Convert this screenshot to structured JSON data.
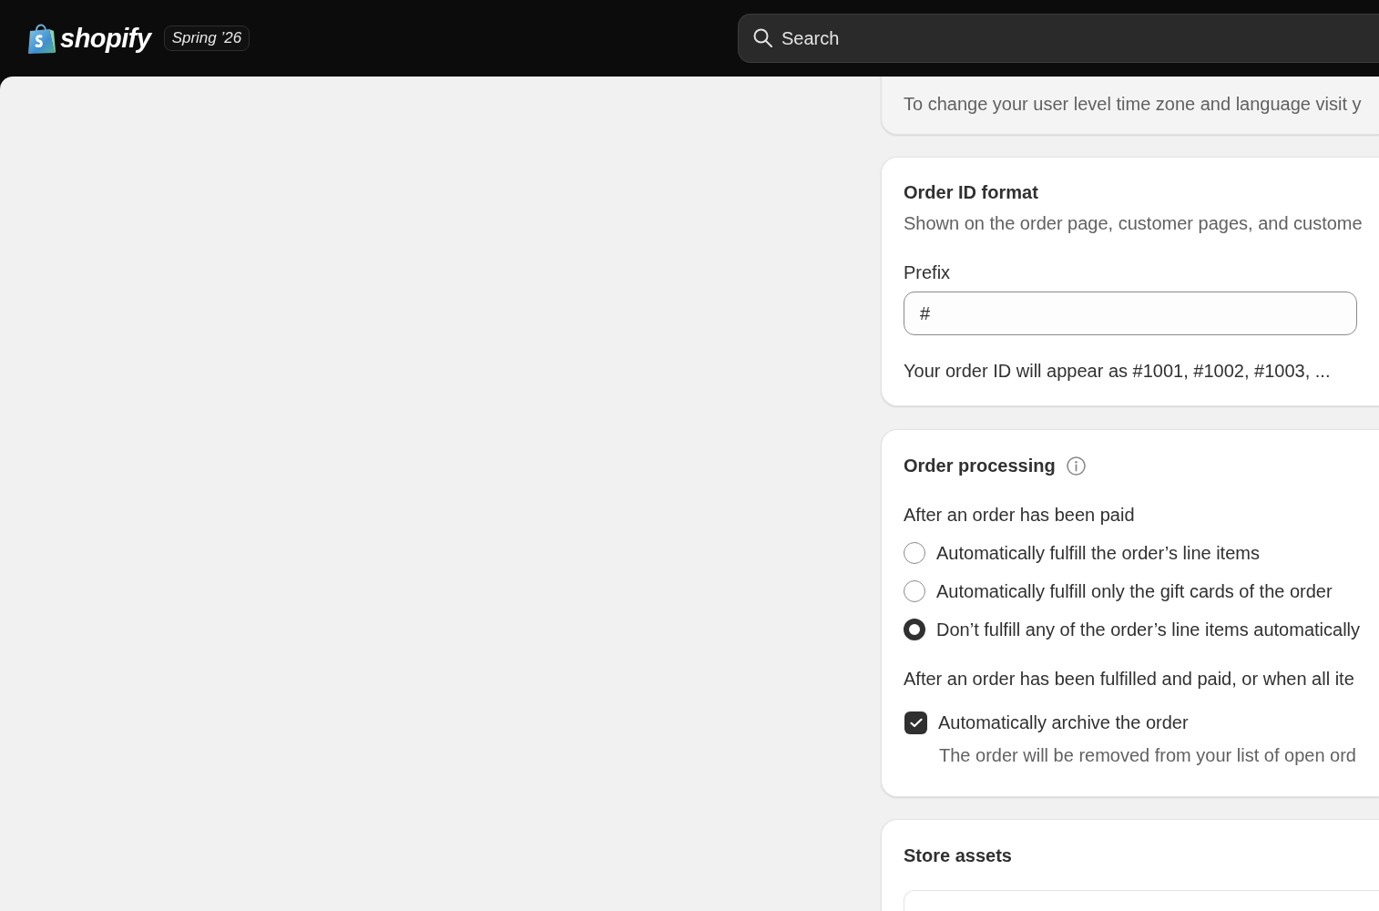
{
  "top_bar": {
    "logo": {
      "wordmark": "shopify"
    },
    "badge": "Spring ’26",
    "search": {
      "placeholder": "Search"
    }
  },
  "time_zone_note": {
    "text": "To change your user level time zone and language visit y"
  },
  "order_id_format": {
    "title": "Order ID format",
    "description": "Shown on the order page, customer pages, and custome",
    "field": {
      "label": "Prefix",
      "value": "#"
    },
    "help": "Your order ID will appear as #1001, #1002, #1003, ..."
  },
  "order_processing": {
    "title": "Order processing",
    "groups": [
      {
        "heading": "After an order has been paid",
        "options": [
          {
            "kind": "radio",
            "label": "Automatically fulfill the order’s line items",
            "selected": false
          },
          {
            "kind": "radio",
            "label": "Automatically fulfill only the gift cards of the order",
            "selected": false
          },
          {
            "kind": "radio",
            "label": "Don’t fulfill any of the order’s line items automatically",
            "selected": true
          }
        ]
      },
      {
        "heading": "After an order has been fulfilled and paid, or when all ite",
        "options": [
          {
            "kind": "checkbox",
            "label": "Automatically archive the order",
            "checked": true,
            "description": "The order will be removed from your list of open ord"
          }
        ]
      }
    ]
  },
  "store_assets": {
    "title": "Store assets"
  }
}
